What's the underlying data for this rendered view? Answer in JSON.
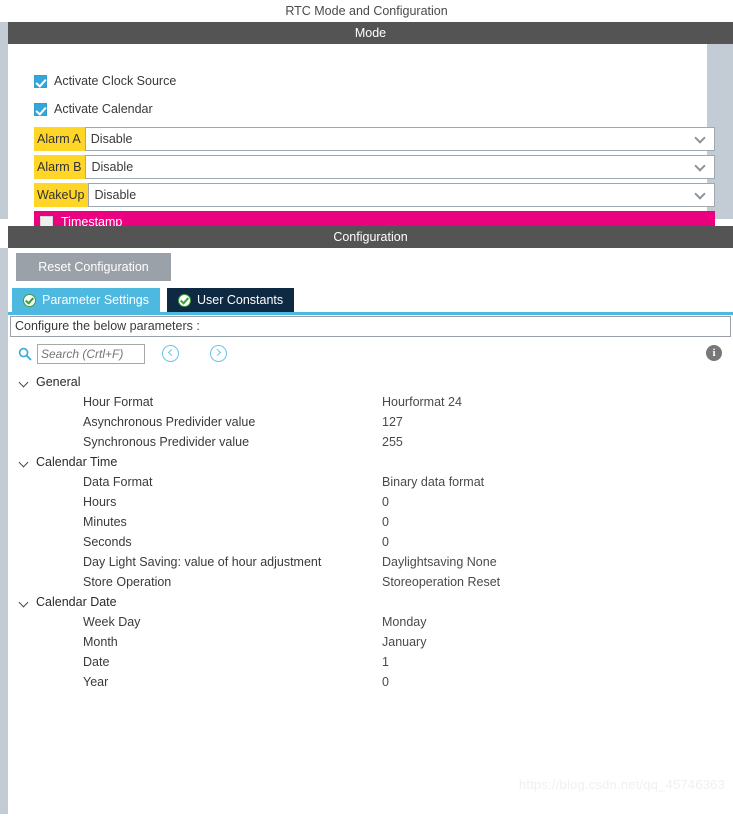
{
  "window": {
    "title": "RTC Mode and Configuration"
  },
  "mode": {
    "band_label": "Mode",
    "checkboxes": [
      {
        "label": "Activate Clock Source",
        "checked": true
      },
      {
        "label": "Activate Calendar",
        "checked": true
      }
    ],
    "dropdowns": [
      {
        "label": "Alarm A",
        "value": "Disable"
      },
      {
        "label": "Alarm B",
        "value": "Disable"
      },
      {
        "label": "WakeUp",
        "value": "Disable"
      }
    ],
    "timestamp": {
      "label": "Timestamp",
      "checked": false
    },
    "highlight_color": "#ffd528",
    "timestamp_color": "#eb0080"
  },
  "configuration": {
    "band_label": "Configuration",
    "reset_button": "Reset Configuration",
    "tabs": [
      {
        "label": "Parameter Settings",
        "active": true
      },
      {
        "label": "User Constants",
        "active": false
      }
    ],
    "note": "Configure the below parameters :",
    "search": {
      "placeholder": "Search (Crtl+F)",
      "value": ""
    },
    "info_icon_label": "i",
    "accent_color": "#4db8e0",
    "tree": [
      {
        "group": "General",
        "expanded": true,
        "rows": [
          {
            "name": "Hour Format",
            "value": "Hourformat 24"
          },
          {
            "name": "Asynchronous Predivider value",
            "value": "127"
          },
          {
            "name": "Synchronous Predivider value",
            "value": "255"
          }
        ]
      },
      {
        "group": "Calendar Time",
        "expanded": true,
        "rows": [
          {
            "name": "Data Format",
            "value": "Binary data format"
          },
          {
            "name": "Hours",
            "value": "0"
          },
          {
            "name": "Minutes",
            "value": "0"
          },
          {
            "name": "Seconds",
            "value": "0"
          },
          {
            "name": "Day Light Saving: value of hour adjustment",
            "value": "Daylightsaving None"
          },
          {
            "name": "Store Operation",
            "value": "Storeoperation Reset"
          }
        ]
      },
      {
        "group": "Calendar Date",
        "expanded": true,
        "rows": [
          {
            "name": "Week Day",
            "value": "Monday"
          },
          {
            "name": "Month",
            "value": "January"
          },
          {
            "name": "Date",
            "value": "1"
          },
          {
            "name": "Year",
            "value": "0"
          }
        ]
      }
    ]
  },
  "watermark": {
    "text": "https://blog.csdn.net/qq_45746363"
  }
}
